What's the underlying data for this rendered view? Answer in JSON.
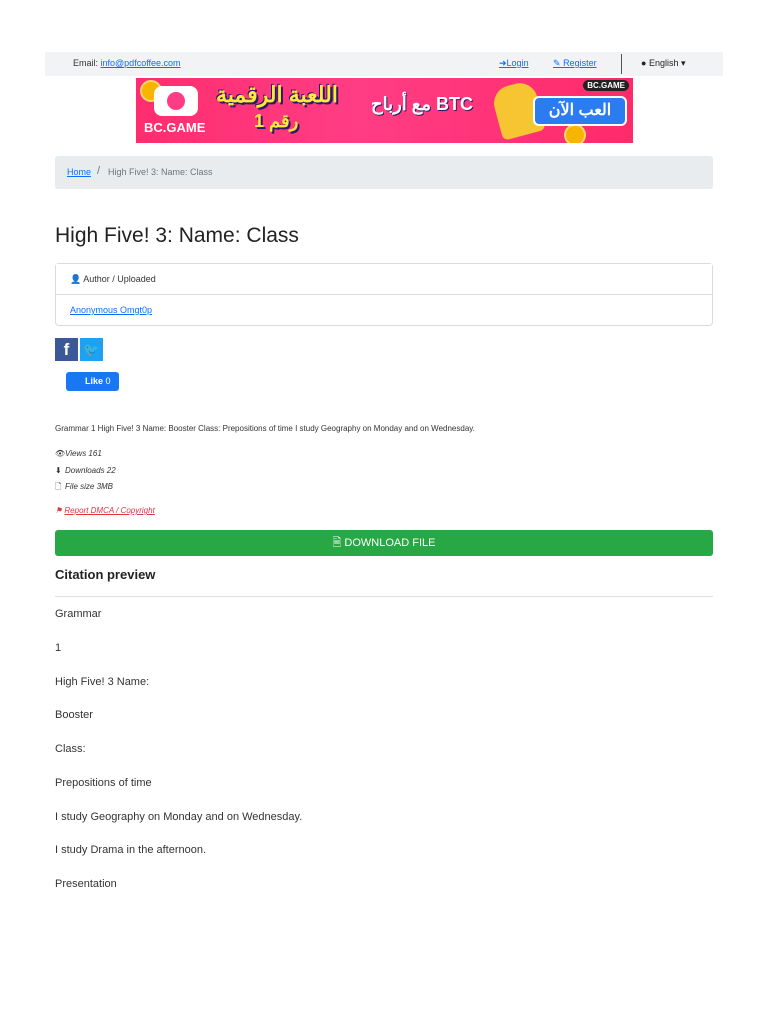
{
  "topbar": {
    "email_label": "Email:",
    "email_value": "info@pdfcoffee.com",
    "login": "Login",
    "register": "Register",
    "language": "English"
  },
  "banner": {
    "brand": "BC.GAME",
    "corner_brand": "BC.GAME",
    "headline": "اللعبة الرقمية",
    "subline": "رقم 1",
    "btc_text": "مع أرباح BTC",
    "play_button": "العب الآن"
  },
  "breadcrumb": {
    "home": "Home",
    "separator": "/",
    "current": "High Five! 3: Name: Class"
  },
  "title": "High Five! 3: Name: Class",
  "author_card": {
    "header": "Author / Uploaded",
    "author": "Anonymous Omgt0p"
  },
  "social": {
    "facebook": "f",
    "twitter": "t",
    "like_label": "Like",
    "like_count": "0"
  },
  "description": "Grammar 1 High Five! 3 Name: Booster Class: Prepositions of time I study Geography on Monday and on Wednesday.",
  "meta": {
    "views": "Views 161",
    "downloads": "Downloads 22",
    "file_size": "File size 3MB"
  },
  "report": "Report DMCA / Copyright",
  "download_button": "DOWNLOAD FILE",
  "citation": {
    "title": "Citation preview",
    "paragraphs": [
      "Grammar",
      "1",
      "High Five! 3 Name:",
      "Booster",
      "Class:",
      "Prepositions of time",
      "I study Geography on Monday and on Wednesday.",
      "I study Drama in the afternoon.",
      "Presentation"
    ]
  }
}
